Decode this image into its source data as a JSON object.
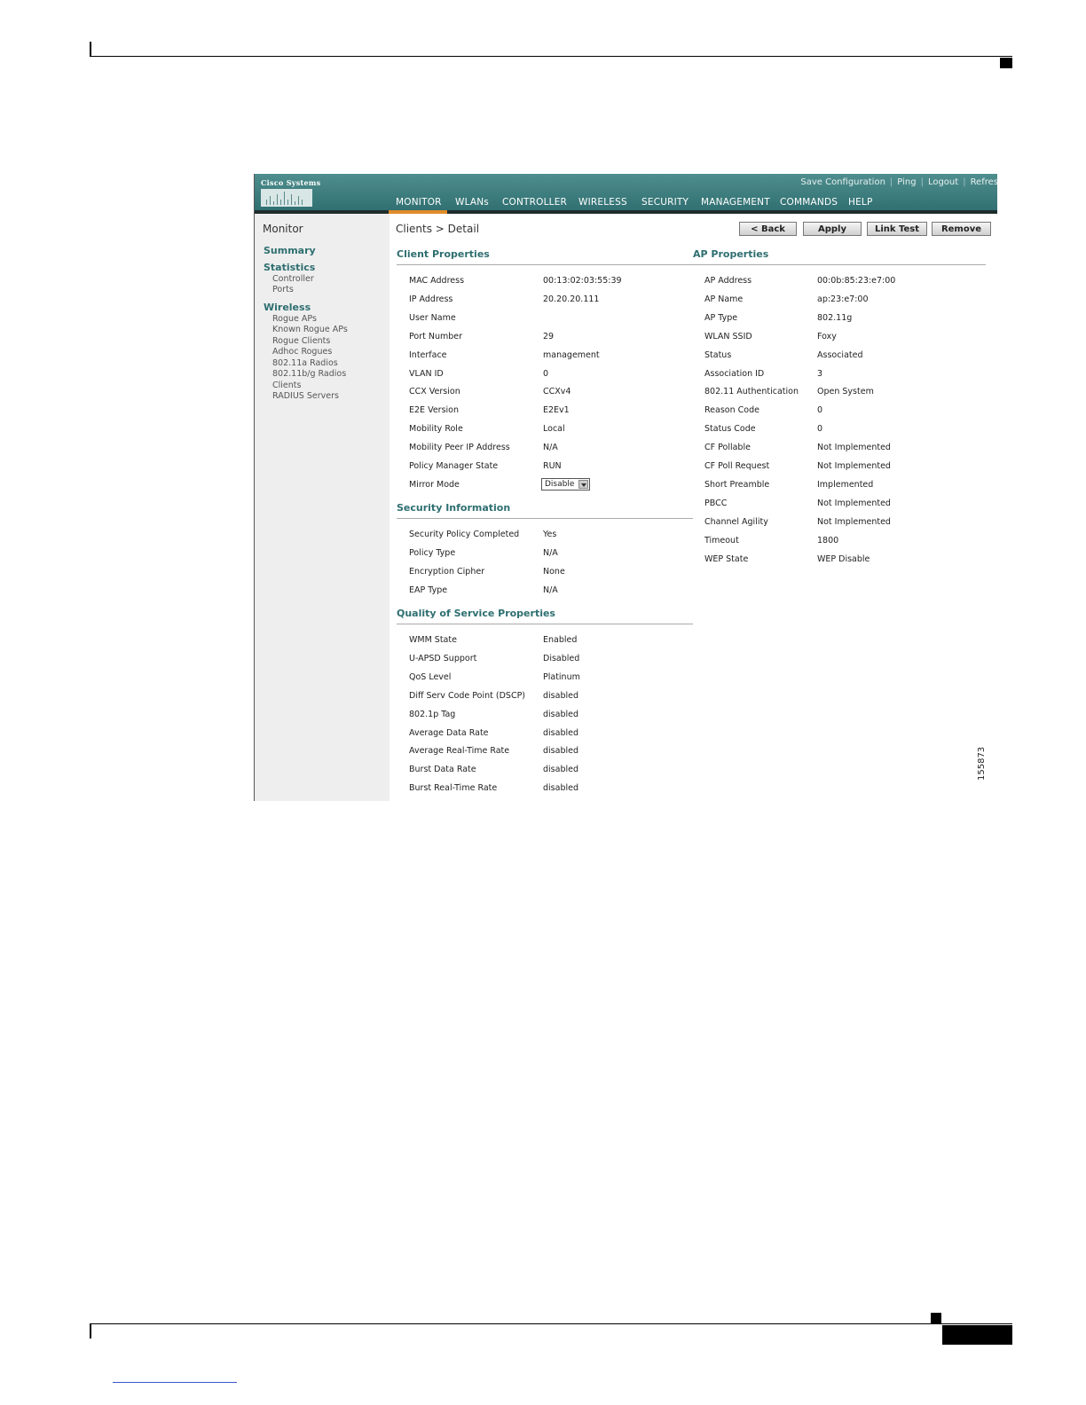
{
  "header": {
    "logo_text": "Cisco Systems",
    "top_links": [
      "Save Configuration",
      "Ping",
      "Logout",
      "Refres"
    ],
    "nav": [
      "MONITOR",
      "WLANs",
      "CONTROLLER",
      "WIRELESS",
      "SECURITY",
      "MANAGEMENT",
      "COMMANDS",
      "HELP"
    ],
    "active_nav": "MONITOR"
  },
  "sidebar": {
    "title": "Monitor",
    "summary": "Summary",
    "statistics": "Statistics",
    "statistics_items": [
      "Controller",
      "Ports"
    ],
    "wireless": "Wireless",
    "wireless_items": [
      "Rogue APs",
      "Known Rogue APs",
      "Rogue Clients",
      "Adhoc Rogues",
      "802.11a Radios",
      "802.11b/g Radios",
      "Clients",
      "RADIUS Servers"
    ]
  },
  "main": {
    "title": "Clients > Detail",
    "buttons": [
      "< Back",
      "Apply",
      "Link Test",
      "Remove"
    ]
  },
  "client_properties": {
    "title": "Client Properties",
    "rows": [
      [
        "MAC Address",
        "00:13:02:03:55:39"
      ],
      [
        "IP Address",
        "20.20.20.111"
      ],
      [
        "User Name",
        ""
      ],
      [
        "Port Number",
        "29"
      ],
      [
        "Interface",
        "management"
      ],
      [
        "VLAN ID",
        "0"
      ],
      [
        "CCX Version",
        "CCXv4"
      ],
      [
        "E2E Version",
        "E2Ev1"
      ],
      [
        "Mobility Role",
        "Local"
      ],
      [
        "Mobility Peer IP Address",
        "N/A"
      ],
      [
        "Policy Manager State",
        "RUN"
      ],
      [
        "Mirror Mode",
        ""
      ]
    ],
    "mirror_mode_value": "Disable"
  },
  "security_information": {
    "title": "Security Information",
    "rows": [
      [
        "Security Policy Completed",
        "Yes"
      ],
      [
        "Policy Type",
        "N/A"
      ],
      [
        "Encryption Cipher",
        "None"
      ],
      [
        "EAP Type",
        "N/A"
      ]
    ]
  },
  "qos_properties": {
    "title": "Quality of Service Properties",
    "rows": [
      [
        "WMM State",
        "Enabled"
      ],
      [
        "U-APSD Support",
        "Disabled"
      ],
      [
        "QoS Level",
        "Platinum"
      ],
      [
        "Diff Serv Code Point (DSCP)",
        "disabled"
      ],
      [
        "802.1p Tag",
        "disabled"
      ],
      [
        "Average Data Rate",
        "disabled"
      ],
      [
        "Average Real-Time Rate",
        "disabled"
      ],
      [
        "Burst Data Rate",
        "disabled"
      ],
      [
        "Burst Real-Time Rate",
        "disabled"
      ]
    ]
  },
  "ap_properties": {
    "title": "AP Properties",
    "rows": [
      [
        "AP Address",
        "00:0b:85:23:e7:00"
      ],
      [
        "AP Name",
        "ap:23:e7:00"
      ],
      [
        "AP Type",
        "802.11g"
      ],
      [
        "WLAN SSID",
        "Foxy"
      ],
      [
        "Status",
        "Associated"
      ],
      [
        "Association ID",
        "3"
      ],
      [
        "802.11 Authentication",
        "Open System"
      ],
      [
        "Reason Code",
        "0"
      ],
      [
        "Status Code",
        "0"
      ],
      [
        "CF Pollable",
        "Not Implemented"
      ],
      [
        "CF Poll Request",
        "Not Implemented"
      ],
      [
        "Short Preamble",
        "Implemented"
      ],
      [
        "PBCC",
        "Not Implemented"
      ],
      [
        "Channel Agility",
        "Not Implemented"
      ],
      [
        "Timeout",
        "1800"
      ],
      [
        "WEP State",
        "WEP Disable"
      ]
    ]
  },
  "figure_number": "155873",
  "colors": {
    "header": "#2f6e70",
    "accent": "#e08b2a",
    "section_title": "#2e6e70",
    "sidebar_bg": "#eeeeee"
  }
}
